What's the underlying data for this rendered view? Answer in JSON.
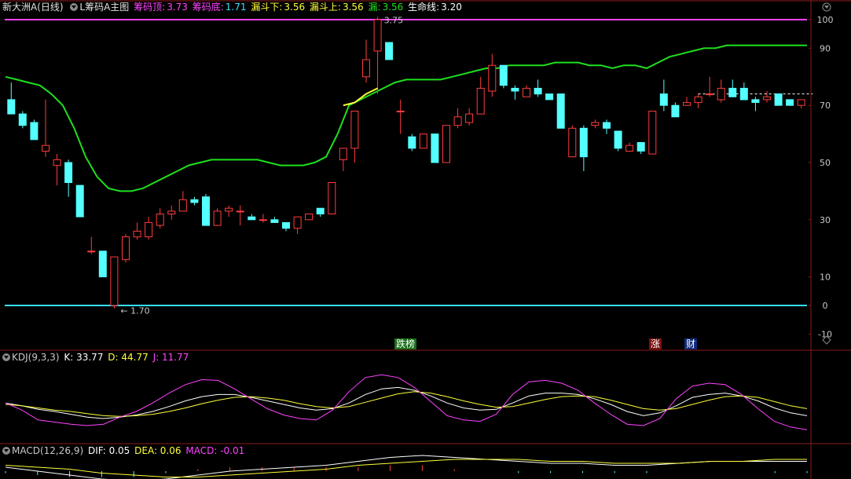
{
  "main_header": {
    "stock": "新大洲A(日线)",
    "indicator": "L筹码A主图",
    "top_label": "筹码顶:",
    "top_value": "3.73",
    "bottom_label": "筹码底:",
    "bottom_value": "1.71",
    "funnel_low_label": "漏斗下:",
    "funnel_low_value": "3.56",
    "funnel_high_label": "漏斗上:",
    "funnel_high_value": "3.56",
    "funnel_label": "漏:",
    "funnel_value": "3.56",
    "life_label": "生命线:",
    "life_value": "3.20"
  },
  "kdj_header": {
    "name": "KDJ(9,3,3)",
    "k": "K: 33.77",
    "d": "D: 44.77",
    "j": "J: 11.77"
  },
  "macd_header": {
    "name": "MACD(12,26,9)",
    "dif": "DIF: 0.05",
    "dea": "DEA: 0.06",
    "macd": "MACD: -0.01"
  },
  "markers": {
    "drop_list": "跌榜",
    "rise": "涨",
    "finance": "财",
    "high_label": "3.75",
    "low_label": "1.70"
  },
  "colors": {
    "up": "#ff3c3c",
    "down": "#54ffff",
    "life": "#1ee01e",
    "magenta": "#ff44ff",
    "yellow": "#ffff3c",
    "white": "#ffffff",
    "axis": "#c8c8c8",
    "border": "#8a1a1a",
    "cyan": "#36e0ff"
  },
  "chart_data": [
    {
      "type": "candlestick",
      "title": "L筹码A主图",
      "y_ticks": [
        100,
        90,
        70,
        50,
        30,
        10,
        0,
        -10
      ],
      "ylim": [
        -10,
        100
      ],
      "candles": [
        {
          "o": 72,
          "c": 67,
          "h": 78,
          "l": 67
        },
        {
          "o": 67,
          "c": 63,
          "h": 68,
          "l": 62
        },
        {
          "o": 64,
          "c": 58,
          "h": 65,
          "l": 58
        },
        {
          "o": 54,
          "c": 56,
          "h": 72,
          "l": 52
        },
        {
          "o": 49,
          "c": 51,
          "h": 53,
          "l": 42
        },
        {
          "o": 50,
          "c": 43,
          "h": 51,
          "l": 38
        },
        {
          "o": 42,
          "c": 31,
          "h": 42,
          "l": 31
        },
        {
          "o": 19,
          "c": 19,
          "h": 24,
          "l": 18
        },
        {
          "o": 19,
          "c": 10,
          "h": 19,
          "l": 10
        },
        {
          "o": 0,
          "c": 17,
          "h": 17,
          "l": -1
        },
        {
          "o": 16,
          "c": 24,
          "h": 25,
          "l": 15
        },
        {
          "o": 24,
          "c": 26,
          "h": 29,
          "l": 23
        },
        {
          "o": 24,
          "c": 29,
          "h": 31,
          "l": 23
        },
        {
          "o": 28,
          "c": 32,
          "h": 34,
          "l": 27
        },
        {
          "o": 32,
          "c": 33,
          "h": 35,
          "l": 30
        },
        {
          "o": 33,
          "c": 37,
          "h": 40,
          "l": 33
        },
        {
          "o": 37,
          "c": 36,
          "h": 38,
          "l": 35
        },
        {
          "o": 38,
          "c": 28,
          "h": 39,
          "l": 28
        },
        {
          "o": 28,
          "c": 33,
          "h": 34,
          "l": 28
        },
        {
          "o": 33,
          "c": 34,
          "h": 35,
          "l": 31
        },
        {
          "o": 33,
          "c": 33,
          "h": 35,
          "l": 28
        },
        {
          "o": 31,
          "c": 30,
          "h": 32,
          "l": 30
        },
        {
          "o": 30,
          "c": 30,
          "h": 32,
          "l": 29
        },
        {
          "o": 30,
          "c": 29,
          "h": 31,
          "l": 29
        },
        {
          "o": 29,
          "c": 27,
          "h": 29,
          "l": 26
        },
        {
          "o": 27,
          "c": 31,
          "h": 31,
          "l": 25
        },
        {
          "o": 30,
          "c": 32,
          "h": 32,
          "l": 30
        },
        {
          "o": 34,
          "c": 32,
          "h": 34,
          "l": 31
        },
        {
          "o": 32,
          "c": 43,
          "h": 43,
          "l": 32
        },
        {
          "o": 51,
          "c": 55,
          "h": 55,
          "l": 47
        },
        {
          "o": 55,
          "c": 68,
          "h": 68,
          "l": 50
        },
        {
          "o": 80,
          "c": 86,
          "h": 93,
          "l": 78
        },
        {
          "o": 89,
          "c": 100,
          "h": 101,
          "l": 74
        },
        {
          "o": 92,
          "c": 86,
          "h": 92,
          "l": 86
        },
        {
          "o": 68,
          "c": 68,
          "h": 72,
          "l": 60
        },
        {
          "o": 59,
          "c": 55,
          "h": 60,
          "l": 54
        },
        {
          "o": 55,
          "c": 60,
          "h": 60,
          "l": 55
        },
        {
          "o": 60,
          "c": 50,
          "h": 60,
          "l": 50
        },
        {
          "o": 50,
          "c": 63,
          "h": 63,
          "l": 50
        },
        {
          "o": 63,
          "c": 66,
          "h": 69,
          "l": 62
        },
        {
          "o": 64,
          "c": 67,
          "h": 69,
          "l": 63
        },
        {
          "o": 67,
          "c": 76,
          "h": 80,
          "l": 67
        },
        {
          "o": 75,
          "c": 84,
          "h": 88,
          "l": 73
        },
        {
          "o": 84,
          "c": 77,
          "h": 84,
          "l": 76
        },
        {
          "o": 76,
          "c": 75,
          "h": 77,
          "l": 72
        },
        {
          "o": 73,
          "c": 76,
          "h": 77,
          "l": 73
        },
        {
          "o": 76,
          "c": 74,
          "h": 79,
          "l": 73
        },
        {
          "o": 74,
          "c": 72,
          "h": 74,
          "l": 72
        },
        {
          "o": 74,
          "c": 62,
          "h": 74,
          "l": 62
        },
        {
          "o": 52,
          "c": 62,
          "h": 63,
          "l": 52
        },
        {
          "o": 62,
          "c": 52,
          "h": 63,
          "l": 47
        },
        {
          "o": 63,
          "c": 64,
          "h": 65,
          "l": 62
        },
        {
          "o": 64,
          "c": 62,
          "h": 65,
          "l": 60
        },
        {
          "o": 61,
          "c": 55,
          "h": 61,
          "l": 54
        },
        {
          "o": 54,
          "c": 56,
          "h": 57,
          "l": 54
        },
        {
          "o": 57,
          "c": 54,
          "h": 57,
          "l": 53
        },
        {
          "o": 53,
          "c": 68,
          "h": 68,
          "l": 53
        },
        {
          "o": 74,
          "c": 70,
          "h": 79,
          "l": 68
        },
        {
          "o": 70,
          "c": 66,
          "h": 71,
          "l": 66
        },
        {
          "o": 70,
          "c": 71,
          "h": 73,
          "l": 70
        },
        {
          "o": 71,
          "c": 73,
          "h": 74,
          "l": 69
        },
        {
          "o": 74,
          "c": 74,
          "h": 80,
          "l": 73
        },
        {
          "o": 72,
          "c": 76,
          "h": 79,
          "l": 71
        },
        {
          "o": 76,
          "c": 73,
          "h": 79,
          "l": 73
        },
        {
          "o": 76,
          "c": 72,
          "h": 78,
          "l": 72
        },
        {
          "o": 72,
          "c": 71,
          "h": 73,
          "l": 68
        },
        {
          "o": 72,
          "c": 73,
          "h": 75,
          "l": 71
        },
        {
          "o": 74,
          "c": 70,
          "h": 74,
          "l": 70
        },
        {
          "o": 72,
          "c": 70,
          "h": 72,
          "l": 70
        },
        {
          "o": 70,
          "c": 72,
          "h": 72,
          "l": 69
        }
      ],
      "life_line": [
        80,
        79,
        78,
        77,
        74,
        70,
        62,
        52,
        45,
        41,
        40,
        40,
        41,
        43,
        45,
        47,
        49,
        50,
        51,
        51,
        51,
        51,
        51,
        50,
        49,
        49,
        49,
        50,
        52,
        60,
        70,
        72,
        74,
        76,
        78,
        79,
        79,
        79,
        79,
        80,
        81,
        82,
        83,
        83,
        84,
        84,
        84,
        84,
        85,
        85,
        85,
        84,
        84,
        83,
        84,
        84,
        83,
        85,
        87,
        88,
        89,
        90,
        90,
        91,
        91,
        91,
        91,
        91,
        91,
        91,
        91
      ],
      "yellow_segment": [
        {
          "i": 29,
          "v": 70
        },
        {
          "i": 30,
          "v": 71
        },
        {
          "i": 31,
          "v": 74
        },
        {
          "i": 32,
          "v": 76
        }
      ],
      "top_line": 100,
      "bottom_line": 0,
      "dashed_level": 74
    },
    {
      "type": "line",
      "title": "KDJ(9,3,3)",
      "series": [
        {
          "name": "K",
          "values": [
            52,
            48,
            43,
            40,
            36,
            32,
            30,
            32,
            35,
            40,
            47,
            55,
            61,
            64,
            64,
            60,
            55,
            50,
            45,
            42,
            44,
            52,
            64,
            72,
            74,
            70,
            62,
            52,
            45,
            42,
            43,
            52,
            62,
            66,
            66,
            64,
            58,
            50,
            40,
            34,
            38,
            48,
            60,
            64,
            66,
            62,
            55,
            45,
            38,
            34
          ]
        },
        {
          "name": "D",
          "values": [
            50,
            48,
            45,
            42,
            40,
            37,
            34,
            33,
            34,
            36,
            40,
            45,
            51,
            56,
            60,
            61,
            59,
            56,
            51,
            47,
            45,
            47,
            53,
            59,
            65,
            68,
            66,
            61,
            55,
            50,
            46,
            47,
            52,
            57,
            61,
            62,
            61,
            56,
            50,
            44,
            42,
            44,
            50,
            56,
            61,
            62,
            60,
            54,
            48,
            44
          ]
        },
        {
          "name": "J",
          "values": [
            52,
            42,
            28,
            25,
            22,
            20,
            22,
            32,
            40,
            52,
            66,
            78,
            85,
            84,
            72,
            58,
            44,
            35,
            30,
            28,
            42,
            68,
            88,
            92,
            88,
            74,
            54,
            34,
            28,
            26,
            36,
            64,
            82,
            84,
            80,
            70,
            52,
            36,
            22,
            20,
            30,
            58,
            76,
            80,
            78,
            64,
            44,
            26,
            18,
            14
          ]
        }
      ]
    },
    {
      "type": "bar",
      "title": "MACD(12,26,9)",
      "series": [
        {
          "name": "DIF",
          "values": [
            0.02,
            0.0,
            -0.02,
            -0.04,
            -0.05,
            -0.04,
            -0.02,
            0.0,
            0.01,
            0.02,
            0.03,
            0.05,
            0.07,
            0.08,
            0.07,
            0.06,
            0.05,
            0.04,
            0.04,
            0.03,
            0.03,
            0.04,
            0.05,
            0.05,
            0.05,
            0.05
          ]
        },
        {
          "name": "DEA",
          "values": [
            0.03,
            0.02,
            0.01,
            -0.01,
            -0.02,
            -0.03,
            -0.03,
            -0.02,
            -0.01,
            0.0,
            0.01,
            0.03,
            0.04,
            0.05,
            0.06,
            0.06,
            0.06,
            0.05,
            0.05,
            0.04,
            0.04,
            0.04,
            0.05,
            0.05,
            0.06,
            0.06
          ]
        },
        {
          "name": "MACD",
          "values": [
            -0.01,
            -0.02,
            -0.03,
            -0.03,
            -0.03,
            -0.01,
            0.01,
            0.02,
            0.02,
            0.02,
            0.02,
            0.02,
            0.03,
            0.03,
            0.01,
            0.0,
            -0.01,
            -0.01,
            -0.01,
            -0.01,
            -0.01,
            0.0,
            0.0,
            0.0,
            -0.01,
            -0.01
          ]
        }
      ]
    }
  ]
}
